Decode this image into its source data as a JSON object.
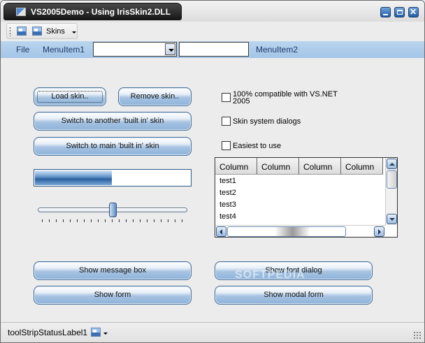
{
  "window": {
    "title": "VS2005Demo - Using IrisSkin2.DLL",
    "accent": "#a3c5e7"
  },
  "toolbar": {
    "skins_label": "Skins"
  },
  "menubar": {
    "items": [
      "File",
      "MenuItem1",
      "MenuItem2"
    ],
    "combo_value": "",
    "textbox_value": ""
  },
  "buttons": {
    "load_skin": "Load skin..",
    "remove_skin": "Remove skin..",
    "switch_builtin": "Switch to another 'built in' skin",
    "switch_main": "Switch to main 'built in' skin",
    "show_message_box": "Show message box",
    "show_form": "Show form",
    "show_font_dialog": "Show font dialog",
    "show_modal_form": "Show modal form"
  },
  "checkboxes": [
    {
      "label_line1": "100% compatible with VS.NET",
      "label_line2": "2005",
      "checked": false
    },
    {
      "label": "Skin system dialogs",
      "checked": false
    },
    {
      "label": "Easiest to use",
      "checked": false
    }
  ],
  "progress": {
    "value_percent": 50
  },
  "slider": {
    "value_percent": 50,
    "ticks": 21
  },
  "listview": {
    "columns": [
      "Column",
      "Column",
      "Column",
      "Column"
    ],
    "rows": [
      "test1",
      "test2",
      "test3",
      "test4"
    ]
  },
  "status": {
    "label": "toolStripStatusLabel1"
  },
  "watermark": {
    "text": "SOFTPEDIA"
  }
}
